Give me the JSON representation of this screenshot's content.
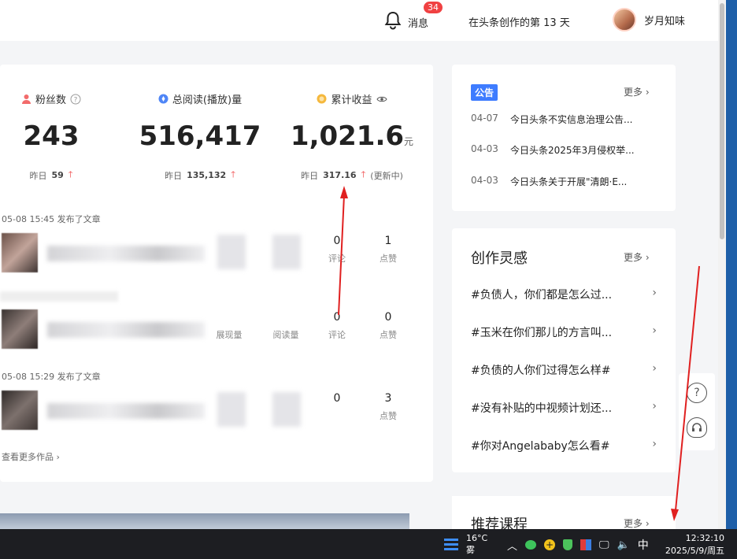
{
  "header": {
    "notification_label": "消息",
    "notification_count": "34",
    "creation_days": "在头条创作的第 13 天",
    "user_name": "岁月知味"
  },
  "metrics": [
    {
      "label": "粉丝数",
      "value": "243",
      "unit": "",
      "yesterday_label": "昨日",
      "yesterday_value": "59",
      "status": ""
    },
    {
      "label": "总阅读(播放)量",
      "value": "516,417",
      "unit": "",
      "yesterday_label": "昨日",
      "yesterday_value": "135,132",
      "status": ""
    },
    {
      "label": "累计收益",
      "value": "1,021.6",
      "unit": "元",
      "yesterday_label": "昨日",
      "yesterday_value": "317.16",
      "status": "(更新中)"
    }
  ],
  "feed": [
    {
      "meta": "05-08 15:45  发布了文章",
      "stats": [
        {
          "value": "0",
          "label": "评论"
        },
        {
          "value": "1",
          "label": "点赞"
        }
      ]
    },
    {
      "meta": "",
      "stats": [
        {
          "value": "0",
          "label": "评论"
        },
        {
          "value": "0",
          "label": "点赞"
        }
      ],
      "extra_labels": [
        "展现量",
        "阅读量"
      ]
    },
    {
      "meta": "05-08 15:29  发布了文章",
      "stats": [
        {
          "value": "0",
          "label": ""
        },
        {
          "value": "3",
          "label": "点赞"
        }
      ]
    }
  ],
  "more_works": "查看更多作品",
  "notice": {
    "pill": "公告",
    "more": "更多",
    "items": [
      {
        "date": "04-07",
        "text": "今日头条不实信息治理公告..."
      },
      {
        "date": "04-03",
        "text": "今日头条2025年3月侵权举..."
      },
      {
        "date": "04-03",
        "text": "今日头条关于开展\"清朗·E..."
      }
    ]
  },
  "inspiration": {
    "title": "创作灵感",
    "more": "更多",
    "topics": [
      "#负债人，你们都是怎么过...",
      "#玉米在你们那儿的方言叫...",
      "#负债的人你们过得怎么样#",
      "#没有补贴的中视频计划还...",
      "#你对Angelababy怎么看#"
    ]
  },
  "courses": {
    "title": "推荐课程",
    "more": "更多"
  },
  "taskbar": {
    "temperature": "16°C",
    "weather": "雾",
    "ime": "中",
    "time": "12:32:10",
    "date": "2025/5/9/周五"
  },
  "colors": {
    "accent": "#3e7cff",
    "alert": "#f04142",
    "arrow": "#e02020"
  },
  "icons": [
    "bell-icon",
    "fans-icon",
    "read-icon",
    "income-icon",
    "help-icon",
    "eye-icon",
    "chevron-right-icon",
    "question-icon",
    "headset-icon"
  ]
}
